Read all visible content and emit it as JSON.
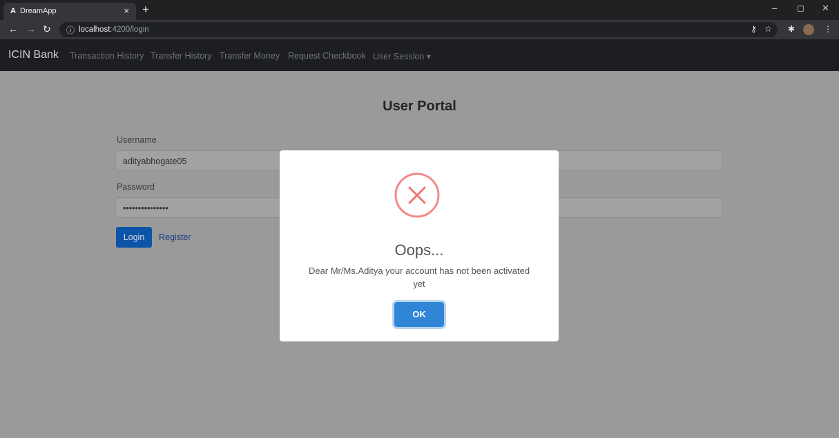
{
  "browser": {
    "tab_favicon": "A",
    "tab_title": "DreamApp",
    "tab_close": "×",
    "new_tab": "+",
    "url_host": "localhost",
    "url_rest": ":4200/login",
    "win_minimize": "–",
    "win_maximize": "◻",
    "win_close": "✕"
  },
  "navbar": {
    "brand": "ICIN Bank",
    "links": [
      "Transaction History",
      "Transfer History",
      "Transfer Money",
      "Request Checkbook",
      "User Session ▾"
    ]
  },
  "page": {
    "title": "User Portal",
    "username_label": "Username",
    "username_value": "adityabhogate05",
    "password_label": "Password",
    "password_value": "•••••••••••••••",
    "login_button": "Login",
    "register_link": "Register"
  },
  "modal": {
    "icon": "error-x-icon",
    "title": "Oops...",
    "text": "Dear Mr/Ms.Aditya your account has not been activated yet",
    "ok_button": "OK"
  },
  "colors": {
    "overlay_bg": "#9a9a9a",
    "navbar_bg": "#1c1e21",
    "primary": "#0d53a8",
    "ok_button": "#3085d6",
    "error_red": "#f27474"
  }
}
